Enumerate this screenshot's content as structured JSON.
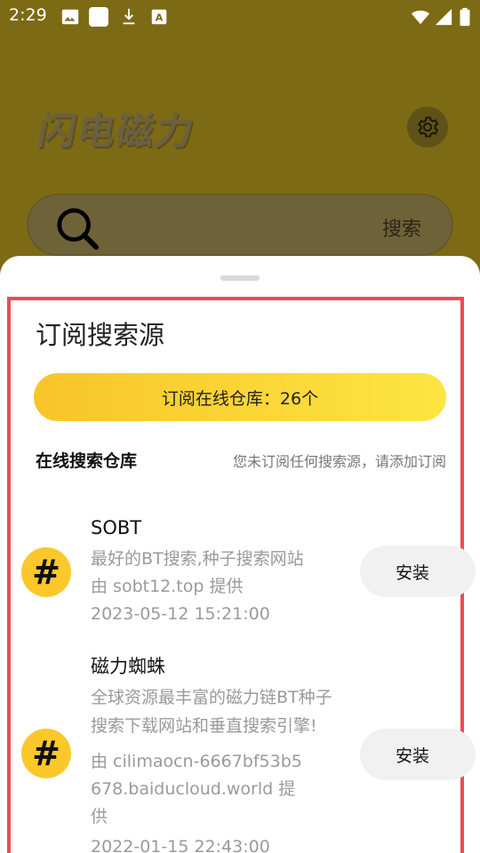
{
  "status_bar": {
    "time": "2:29",
    "icons": [
      "image-icon",
      "square-icon",
      "download-icon",
      "font-a-icon",
      "wifi-icon",
      "signal-icon",
      "battery-icon"
    ]
  },
  "header": {
    "app_title": "闪电磁力",
    "settings_icon": "gear-icon"
  },
  "search": {
    "button_label": "搜索",
    "icon": "search-icon"
  },
  "sheet": {
    "title": "订阅搜索源",
    "subscribe_button": "订阅在线仓库：26个",
    "section_title": "在线搜索仓库",
    "section_hint": "您未订阅任何搜索源，请添加订阅",
    "accent_color": "#fbc82c",
    "highlight_color": "#f04a55",
    "repos": [
      {
        "badge": "#",
        "name": "SOBT",
        "description": "最好的BT搜索,种子搜索网站",
        "provider": "由 sobt12.top 提供",
        "date": "2023-05-12 15:21:00",
        "install_label": "安装"
      },
      {
        "badge": "#",
        "name": "磁力蜘蛛",
        "description_line1": "全球资源最丰富的磁力链BT种子",
        "description_line2": "搜索下载网站和垂直搜索引擎!",
        "provider_line1": "由 cilimaocn-6667bf53b5",
        "provider_line2": "678.baiducloud.world 提",
        "provider_line3": "供",
        "date": "2022-01-15 22:43:00",
        "install_label": "安装"
      }
    ]
  }
}
